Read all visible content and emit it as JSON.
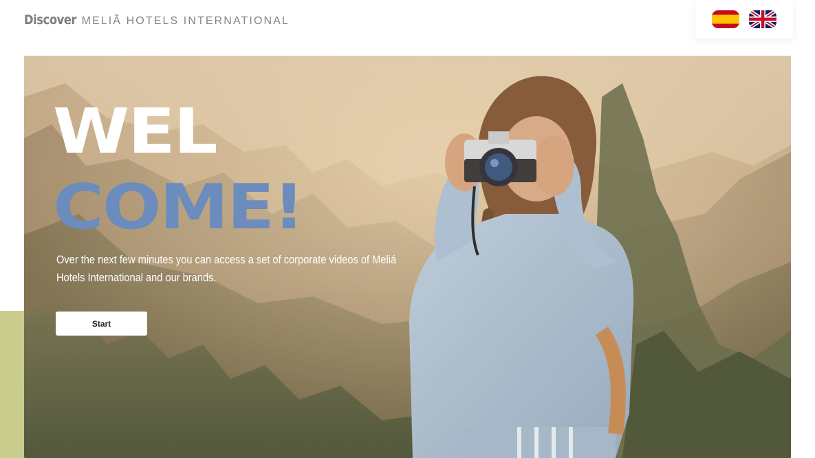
{
  "header": {
    "brand_discover": "Discover",
    "brand_company": "MELIÃ HOTELS INTERNATIONAL",
    "languages": [
      {
        "code": "es",
        "icon": "spain-flag-icon"
      },
      {
        "code": "en",
        "icon": "uk-flag-icon"
      }
    ]
  },
  "hero": {
    "title_line1": "WEL",
    "title_line2": "COME!",
    "description": "Over the next few minutes you can access a set of corporate videos of Meliá Hotels International and our brands.",
    "start_label": "Start",
    "image": "girl-with-camera-photo"
  },
  "colors": {
    "title_accent": "#6b8cbd",
    "side_accent": "#c8cc8c",
    "button_bg": "#ffffff"
  }
}
